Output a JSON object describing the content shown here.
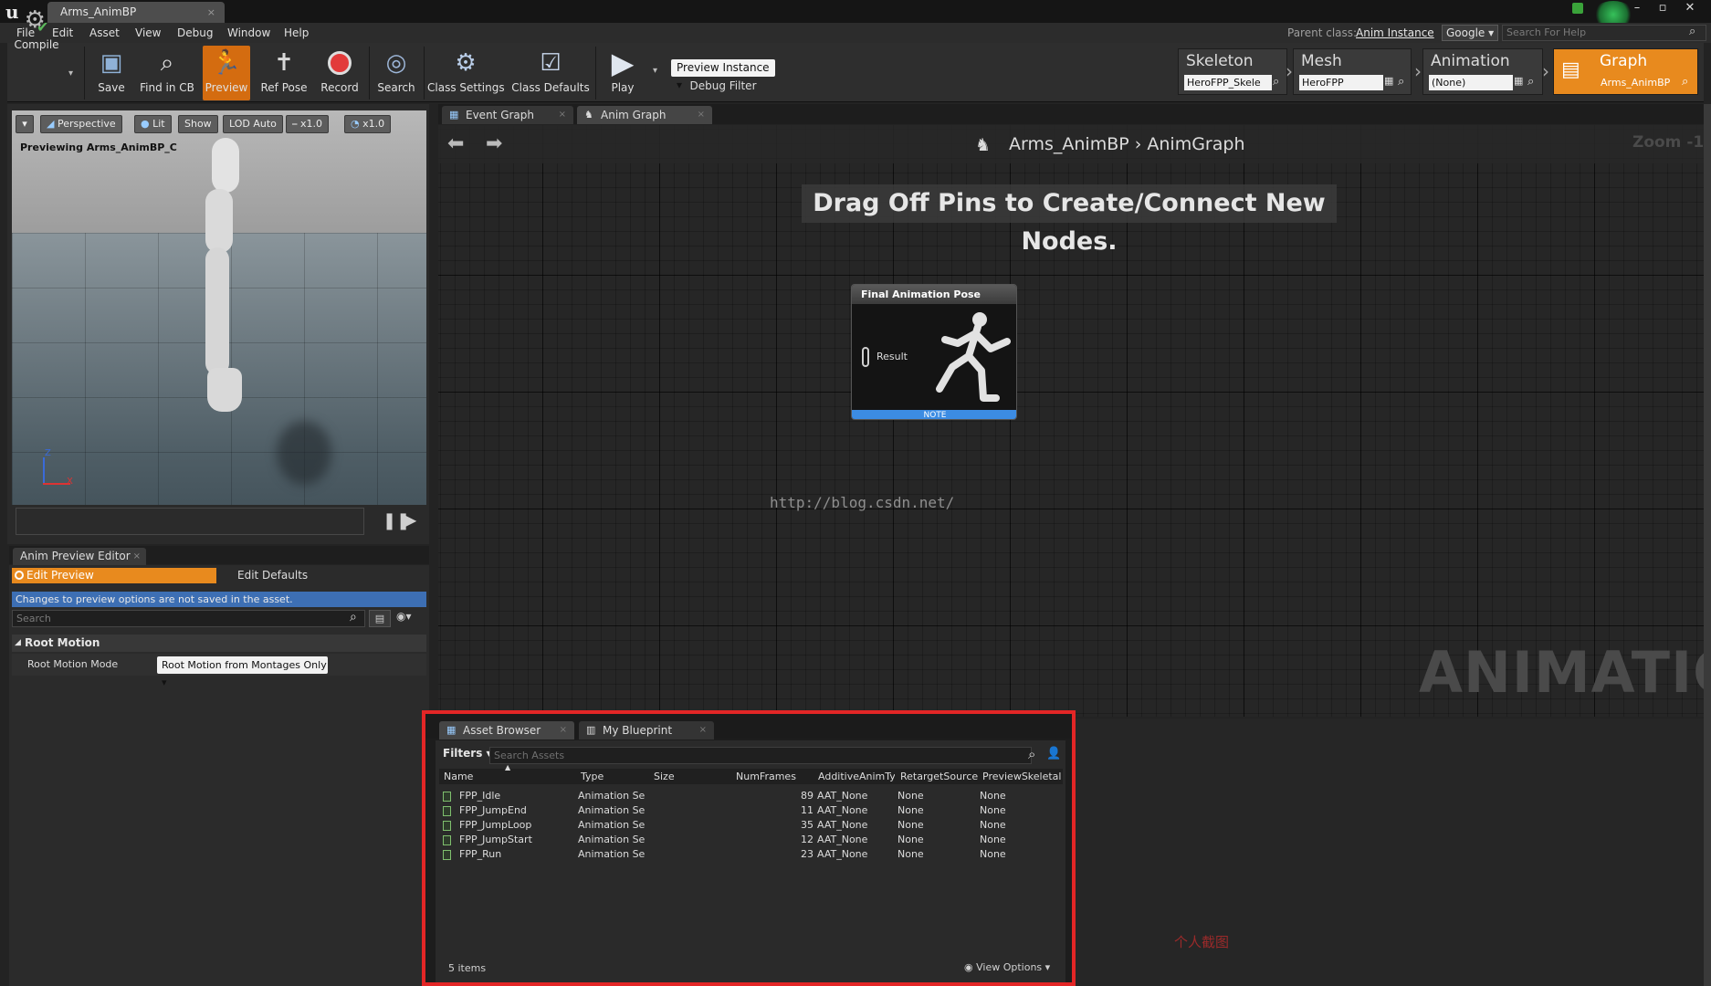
{
  "titlebar": {
    "logo": "u",
    "tab_title": "Arms_AnimBP",
    "tab_close": "×",
    "window_buttons": [
      "–",
      "▫",
      "✕"
    ]
  },
  "menu": {
    "items": [
      "File",
      "Edit",
      "Asset",
      "View",
      "Debug",
      "Window",
      "Help"
    ],
    "parent_class_label": "Parent class:",
    "parent_class_value": "Anim Instance",
    "search_engine": "Google ▾",
    "help_search_placeholder": "Search For Help"
  },
  "toolbar": {
    "compile": "Compile",
    "save": "Save",
    "find_in_cb": "Find in CB",
    "preview": "Preview",
    "ref_pose": "Ref Pose",
    "record": "Record",
    "search": "Search",
    "class_settings": "Class Settings",
    "class_defaults": "Class Defaults",
    "play": "Play",
    "preview_instance": "Preview Instance ▾",
    "debug_filter": "Debug Filter"
  },
  "modes": {
    "skeleton": {
      "title": "Skeleton",
      "value": "HeroFPP_Skele"
    },
    "mesh": {
      "title": "Mesh",
      "value": "HeroFPP"
    },
    "animation": {
      "title": "Animation",
      "value": "(None)"
    },
    "graph": {
      "title": "Graph",
      "value": "Arms_AnimBP"
    }
  },
  "viewport": {
    "buttons": [
      "▾",
      "Perspective",
      "Lit",
      "Show",
      "LOD Auto",
      "x1.0",
      "x1.0"
    ],
    "caption": "Previewing Arms_AnimBP_C"
  },
  "anim_preview_editor": {
    "tab": "Anim Preview Editor",
    "tab_close": "×",
    "edit_preview": "Edit Preview",
    "edit_defaults": "Edit Defaults",
    "note": "Changes to preview options are not saved in the asset.",
    "search_placeholder": "Search",
    "section": "Root Motion",
    "root_motion_mode_label": "Root Motion Mode",
    "root_motion_mode_value": "Root Motion from Montages Only ▾"
  },
  "graph": {
    "tabs": [
      {
        "label": "Event Graph",
        "close": "×"
      },
      {
        "label": "Anim Graph",
        "close": "×"
      }
    ],
    "breadcrumb": "Arms_AnimBP  ›  AnimGraph",
    "zoom": "Zoom -1",
    "hint": "Drag Off Pins to Create/Connect New Nodes.",
    "watermark": "ANIMATION",
    "node": {
      "title": "Final Animation Pose",
      "pin_label": "Result",
      "footer": "NOTE"
    },
    "overlay_url": "http://blog.csdn.net/"
  },
  "asset_browser": {
    "tabs": [
      {
        "label": "Asset Browser",
        "close": "×"
      },
      {
        "label": "My Blueprint",
        "close": "×"
      }
    ],
    "filters_label": "Filters ▾",
    "search_placeholder": "Search Assets",
    "columns": [
      "Name",
      "Type",
      "Size",
      "NumFrames",
      "AdditiveAnimTy",
      "RetargetSource",
      "PreviewSkeletal"
    ],
    "rows": [
      {
        "name": "FPP_Idle",
        "type": "Animation Se",
        "size": "",
        "frames": "89",
        "additive": "AAT_None",
        "retarget": "None",
        "preview": "None"
      },
      {
        "name": "FPP_JumpEnd",
        "type": "Animation Se",
        "size": "",
        "frames": "11",
        "additive": "AAT_None",
        "retarget": "None",
        "preview": "None"
      },
      {
        "name": "FPP_JumpLoop",
        "type": "Animation Se",
        "size": "",
        "frames": "35",
        "additive": "AAT_None",
        "retarget": "None",
        "preview": "None"
      },
      {
        "name": "FPP_JumpStart",
        "type": "Animation Se",
        "size": "",
        "frames": "12",
        "additive": "AAT_None",
        "retarget": "None",
        "preview": "None"
      },
      {
        "name": "FPP_Run",
        "type": "Animation Se",
        "size": "",
        "frames": "23",
        "additive": "AAT_None",
        "retarget": "None",
        "preview": "None"
      }
    ],
    "item_count": "5 items",
    "view_options": "View Options ▾"
  },
  "annotation_note": "个人截图",
  "colors": {
    "accent_orange": "#e88a1e",
    "highlight_red": "#e32626",
    "info_blue": "#3d6fb4"
  }
}
